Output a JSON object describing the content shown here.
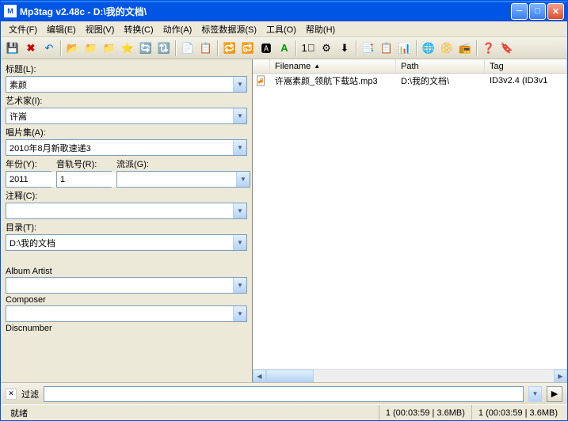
{
  "window": {
    "title": "Mp3tag v2.48c   -   D:\\我的文档\\"
  },
  "menu": {
    "file": "文件(F)",
    "edit": "编辑(E)",
    "view": "视图(V)",
    "convert": "转换(C)",
    "action": "动作(A)",
    "tagsource": "标签数据源(S)",
    "tools": "工具(O)",
    "help": "帮助(H)"
  },
  "toolbar_icons": {
    "save": "💾",
    "delete": "✖",
    "undo": "↶",
    "open": "📂",
    "newfolder": "📁",
    "fav": "⭐",
    "reload": "🔄",
    "refresh": "🔃",
    "doc1": "📄",
    "doc2": "📋",
    "t1": "🔁",
    "t2": "🔂",
    "t3": "🅰",
    "t4": "A",
    "num": "1⃣",
    "a1": "⚙",
    "a2": "⬇",
    "b1": "📑",
    "b2": "📋",
    "b3": "📊",
    "c1": "🌐",
    "c2": "📀",
    "c3": "📻",
    "help": "❓",
    "flag": "🔖"
  },
  "fields": {
    "title_label": "标题(L):",
    "title_value": "素颜",
    "artist_label": "艺术家(I):",
    "artist_value": "许嵩",
    "album_label": "唱片集(A):",
    "album_value": "2010年8月新歌速递3",
    "year_label": "年份(Y):",
    "year_value": "2011",
    "track_label": "音轨号(R):",
    "track_value": "1",
    "genre_label": "流派(G):",
    "genre_value": "",
    "comment_label": "注释(C):",
    "comment_value": "",
    "directory_label": "目录(T):",
    "directory_value": "D:\\我的文档",
    "albumartist_label": "Album Artist",
    "albumartist_value": "",
    "composer_label": "Composer",
    "composer_value": "",
    "discnumber_label": "Discnumber"
  },
  "filelist": {
    "columns": {
      "filename": "Filename",
      "path": "Path",
      "tag": "Tag"
    },
    "rows": [
      {
        "filename": "许嵩素颜_领航下载站.mp3",
        "path": "D:\\我的文档\\",
        "tag": "ID3v2.4 (ID3v1"
      }
    ]
  },
  "filter": {
    "label": "过滤"
  },
  "status": {
    "ready": "就绪",
    "seg1": "1 (00:03:59 | 3.6MB)",
    "seg2": "1 (00:03:59 | 3.6MB)"
  }
}
